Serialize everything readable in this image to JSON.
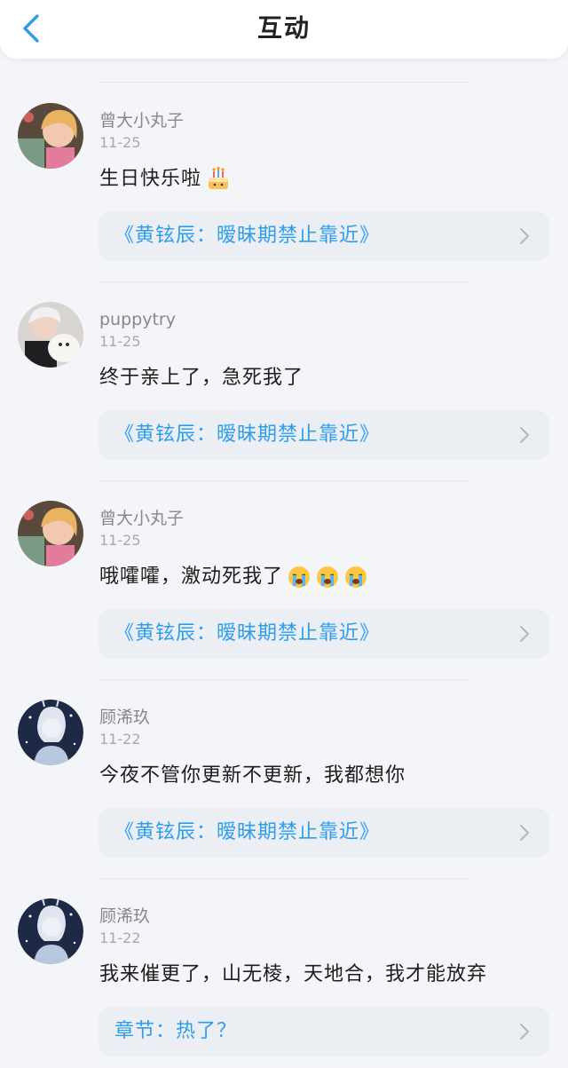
{
  "header": {
    "title": "互动",
    "back_icon": "chevron-left-icon"
  },
  "accent_color": "#2f9ee9",
  "comments": [
    {
      "user": "曾大小丸子",
      "date": "11-25",
      "message": "生日快乐啦",
      "emoji": [
        "birthday-cake-emoji"
      ],
      "link": "《黄铉辰：暧昧期禁止靠近》"
    },
    {
      "user": "puppytry",
      "date": "11-25",
      "message": "终于亲上了，急死我了",
      "emoji": [],
      "link": "《黄铉辰：暧昧期禁止靠近》"
    },
    {
      "user": "曾大小丸子",
      "date": "11-25",
      "message": "哦嚯嚯，激动死我了",
      "emoji": [
        "crying-face-emoji",
        "crying-face-emoji",
        "crying-face-emoji"
      ],
      "link": "《黄铉辰：暧昧期禁止靠近》"
    },
    {
      "user": "顾浠玖",
      "date": "11-22",
      "message": "今夜不管你更新不更新，我都想你",
      "emoji": [],
      "link": "《黄铉辰：暧昧期禁止靠近》"
    },
    {
      "user": "顾浠玖",
      "date": "11-22",
      "message": "我来催更了，山无棱，天地合，我才能放弃",
      "emoji": [],
      "link": "章节：热了？"
    }
  ]
}
